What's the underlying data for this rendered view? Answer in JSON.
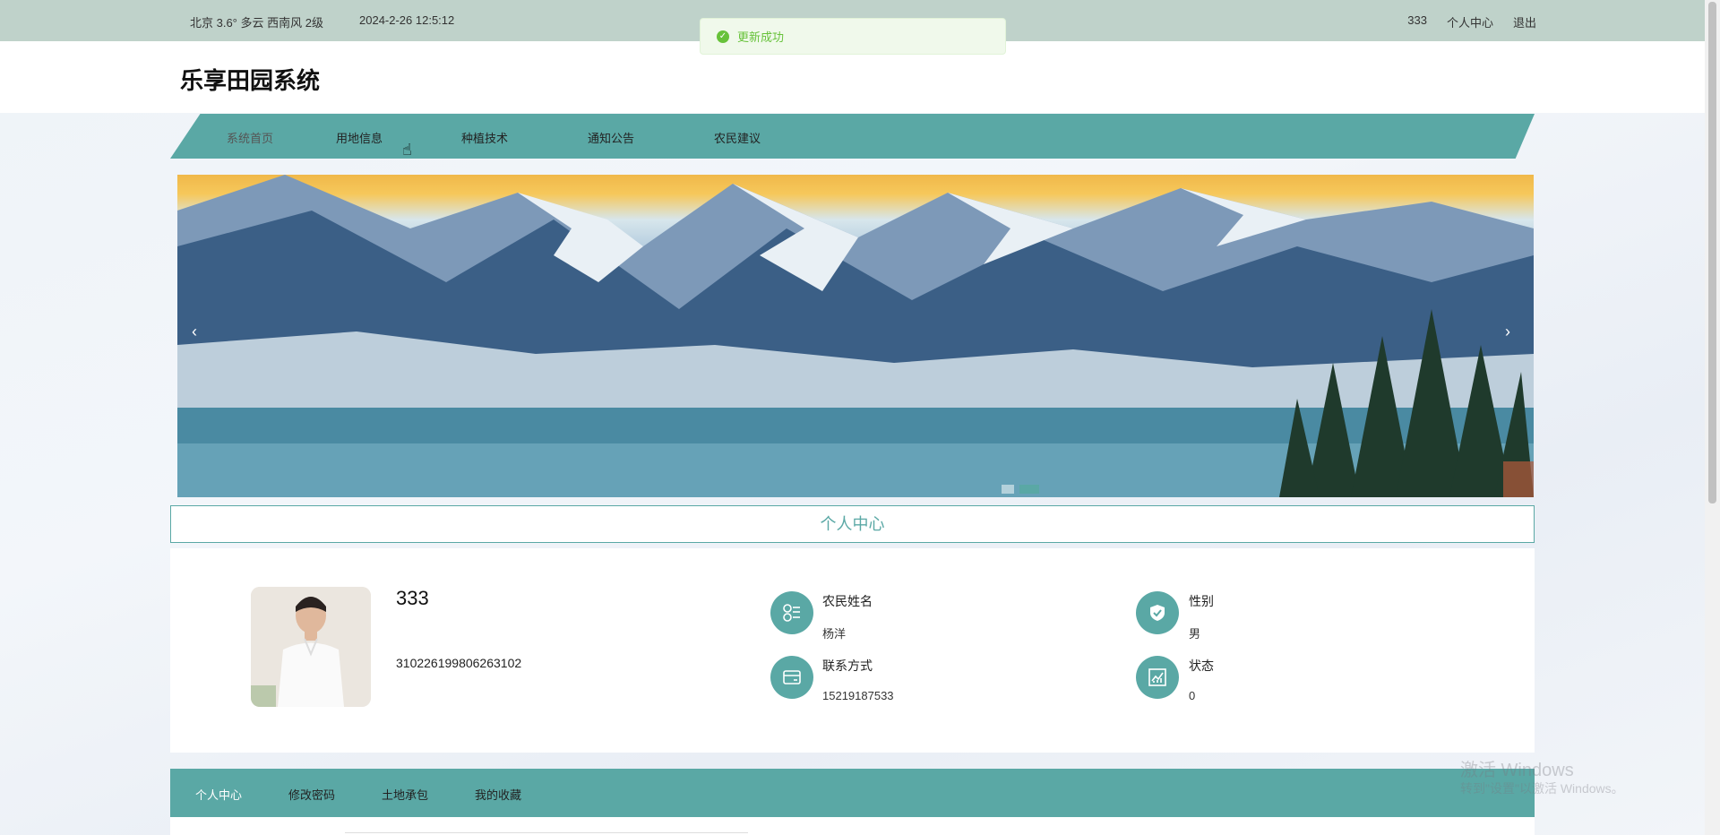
{
  "topbar": {
    "weather": "北京  3.6°  多云  西南风  2级",
    "datetime": "2024-2-26 12:5:12",
    "username": "333",
    "profile_link": "个人中心",
    "logout": "退出"
  },
  "toast": {
    "message": "更新成功"
  },
  "header": {
    "logo": "乐享田园系统"
  },
  "nav": {
    "items": [
      "系统首页",
      "用地信息",
      "种植技术",
      "通知公告",
      "农民建议"
    ]
  },
  "banner": {
    "prev": "‹",
    "next": "›"
  },
  "section": {
    "title": "个人中心"
  },
  "profile": {
    "username": "333",
    "id_number": "310226199806263102",
    "fields": [
      {
        "label": "农民姓名",
        "value": "杨洋",
        "icon": "user-group-icon"
      },
      {
        "label": "性别",
        "value": "男",
        "icon": "shield-check-icon"
      },
      {
        "label": "联系方式",
        "value": "15219187533",
        "icon": "card-icon"
      },
      {
        "label": "状态",
        "value": "0",
        "icon": "chart-icon"
      }
    ]
  },
  "tabs": {
    "items": [
      "个人中心",
      "修改密码",
      "土地承包",
      "我的收藏"
    ]
  },
  "watermark": {
    "line1": "激活 Windows",
    "line2": "转到\"设置\"以激活 Windows。"
  },
  "colors": {
    "accent": "#5aa8a5",
    "topbar": "#bfd2ca",
    "success": "#67c23a"
  }
}
